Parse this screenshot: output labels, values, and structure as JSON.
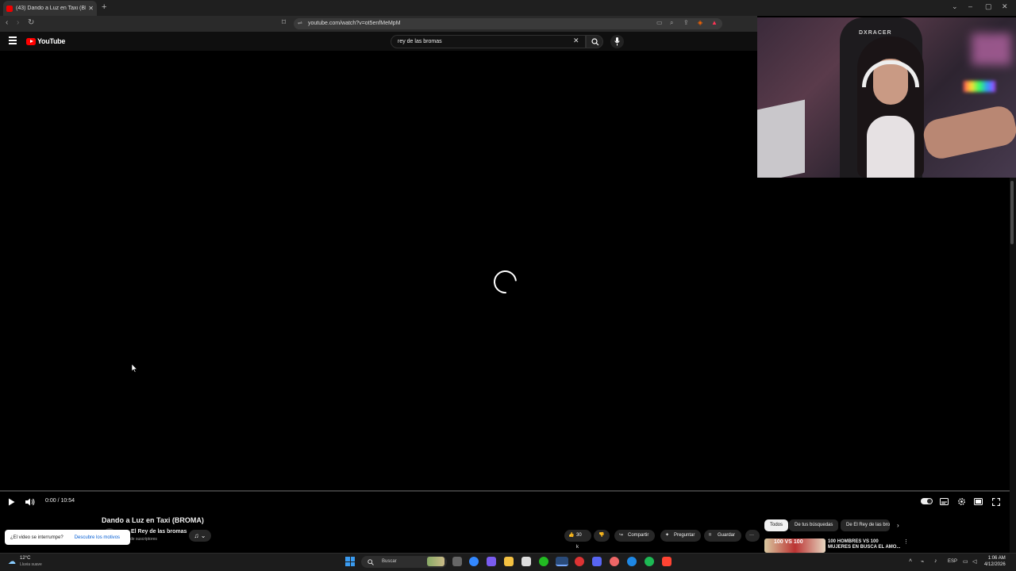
{
  "browser": {
    "tab_title": "(43) Dando a Luz en Taxi (BROM/",
    "url": "youtube.com/watch?v=ot5enfMeMpM"
  },
  "youtube": {
    "logo_text": "YouTube",
    "search_value": "rey de las bromas"
  },
  "webcam": {
    "brand": "DXRACER"
  },
  "player": {
    "time": "0:00 / 10:54",
    "progress": 0
  },
  "video": {
    "title": "Dando a Luz en Taxi (BROMA)",
    "channel": "El Rey de las bromas",
    "subscribers": "de suscriptores",
    "likes": "30 k",
    "share_label": "Compartir",
    "ask_label": "Preguntar",
    "save_label": "Guardar"
  },
  "popup": {
    "question": "¿El video se interrumpe?",
    "link": "Descubre los motivos"
  },
  "chips": [
    "Todos",
    "De tus búsquedas",
    "De El Rey de las bromas"
  ],
  "recommendation": {
    "thumb_text": "100 VS 100",
    "title": "100 HOMBRES VS 100 MUJERES EN BUSCA EL AMO..."
  },
  "taskbar": {
    "temperature": "12°C",
    "weather": "Lluvia suave",
    "search_placeholder": "Buscar",
    "lang": "ESP",
    "time": "1:06 AM",
    "date": "4/12/2026"
  },
  "colors": {
    "accent_red": "#ff0000",
    "link_blue": "#065fd4"
  }
}
